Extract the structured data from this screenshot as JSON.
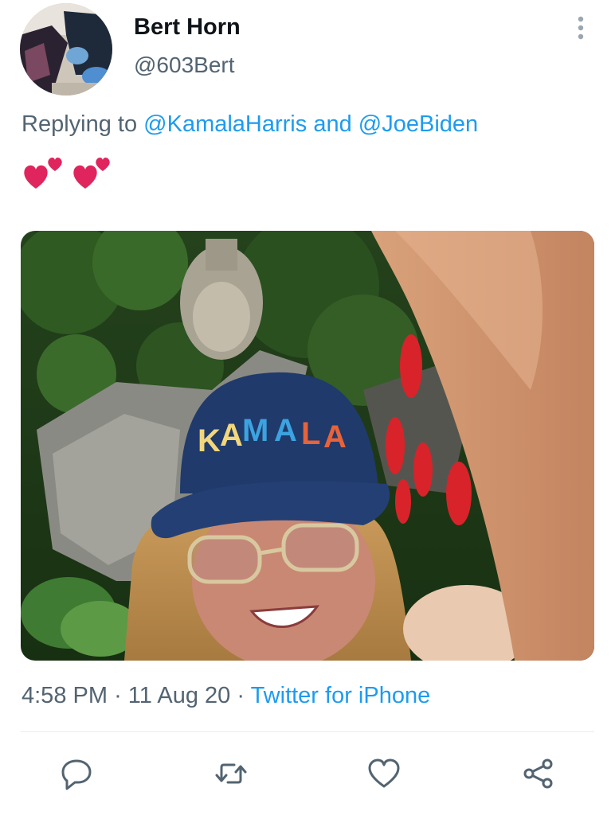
{
  "author": {
    "display_name": "Bert Horn",
    "handle": "@603Bert"
  },
  "reply": {
    "prefix": "Replying to",
    "mention_1": "@KamalaHarris",
    "joiner": "and",
    "mention_2": "@JoeBiden"
  },
  "tweet": {
    "emoji": "two-hearts-icon",
    "photo": {
      "hat_text_letters": [
        "K",
        "A",
        "M",
        "A",
        "L",
        "A"
      ]
    }
  },
  "meta": {
    "time": "4:58 PM",
    "date": "11 Aug 20",
    "source": "Twitter for iPhone",
    "separator": "·"
  },
  "actions": {
    "icons": [
      "reply-icon",
      "retweet-icon",
      "like-icon",
      "share-icon"
    ]
  },
  "colors": {
    "text": "#0f1419",
    "secondary": "#536471",
    "link": "#1d9bf0",
    "heart": "#e0245e",
    "hat": "#1f3a6b"
  }
}
